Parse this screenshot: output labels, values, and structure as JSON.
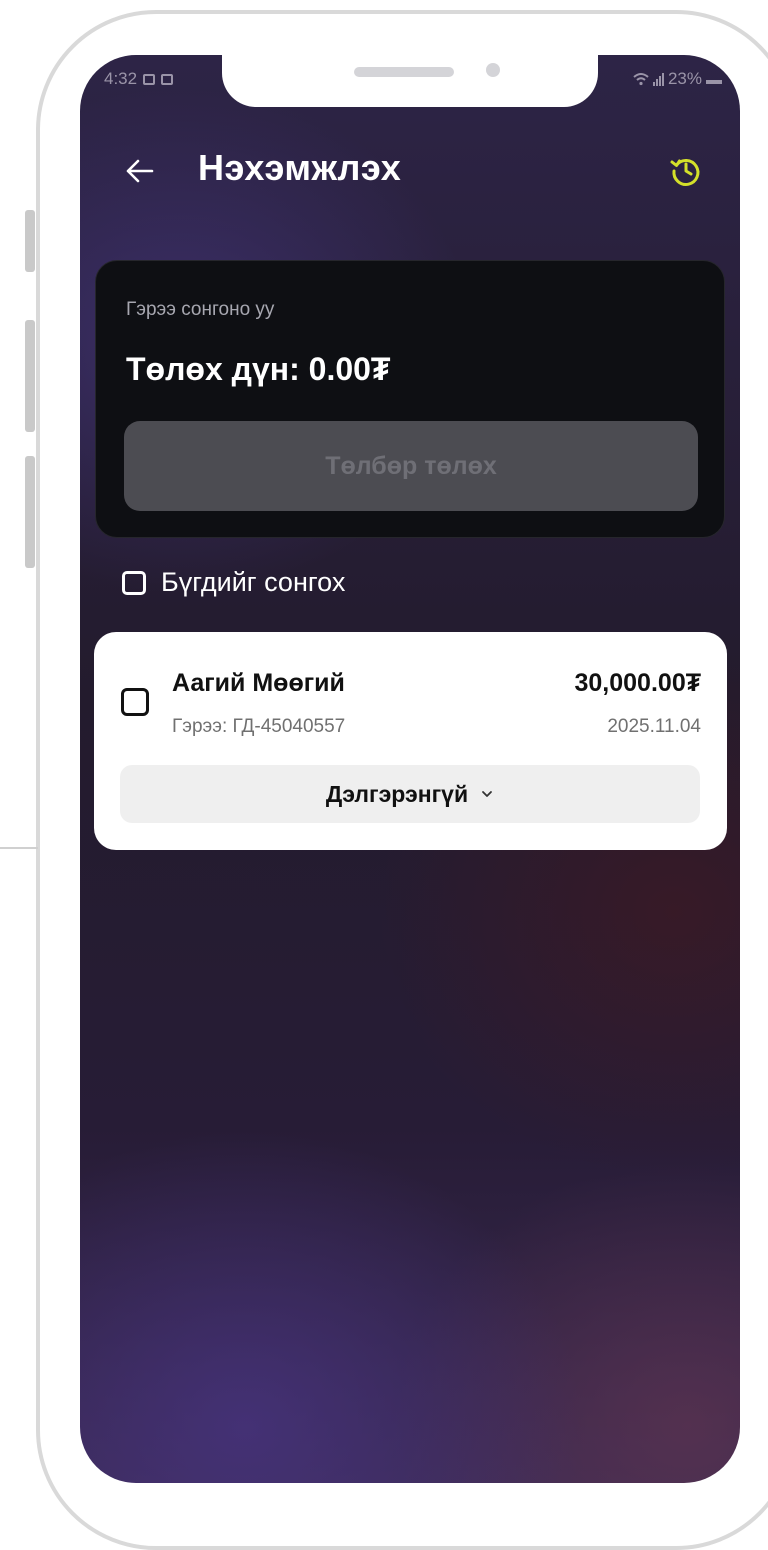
{
  "status_bar": {
    "time": "4:32",
    "battery": "23%"
  },
  "header": {
    "title": "Нэхэмжлэх",
    "back_icon": "arrow-left-icon",
    "history_icon": "history-icon"
  },
  "payment": {
    "subtitle": "Гэрээ сонгоно уу",
    "amount_label": "Төлөх дүн: 0.00₮",
    "pay_button": "Төлбөр төлөх"
  },
  "select_all": {
    "label": "Бүгдийг сонгох",
    "checked": false
  },
  "invoices": [
    {
      "name": "Аагий Мөөгий",
      "amount": "30,000.00₮",
      "contract": "Гэрээ: ГД-45040557",
      "date": "2025.11.04",
      "details_label": "Дэлгэрэнгүй",
      "checked": false
    }
  ],
  "colors": {
    "accent": "#d4e02a",
    "card_dark": "#0e0f13",
    "button_disabled": "#4c4c52"
  }
}
